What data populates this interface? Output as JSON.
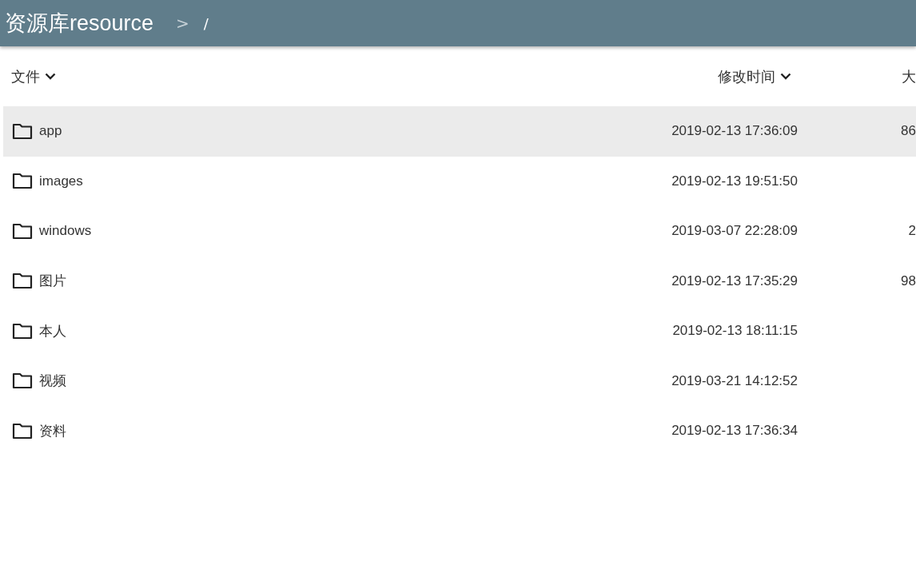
{
  "header": {
    "title": "资源库resource",
    "breadcrumb_separator": ">",
    "path": "/"
  },
  "table": {
    "columns": [
      {
        "label": "文件",
        "sorted": true
      },
      {
        "label": "修改时间",
        "sorted": true
      },
      {
        "label": "大",
        "sorted": false
      }
    ],
    "rows": [
      {
        "name": "app",
        "modified": "2019-02-13 17:36:09",
        "size": "86",
        "selected": true
      },
      {
        "name": "images",
        "modified": "2019-02-13 19:51:50",
        "selected": false
      },
      {
        "name": "windows",
        "modified": "2019-03-07 22:28:09",
        "size": "2",
        "selected": false
      },
      {
        "name": "图片",
        "modified": "2019-02-13 17:35:29",
        "size": "98",
        "selected": false
      },
      {
        "name": "本人",
        "modified": "2019-02-13 18:11:15",
        "selected": false
      },
      {
        "name": "视频",
        "modified": "2019-03-21 14:12:52",
        "selected": false
      },
      {
        "name": "资料",
        "modified": "2019-02-13 17:36:34",
        "selected": false
      }
    ]
  }
}
